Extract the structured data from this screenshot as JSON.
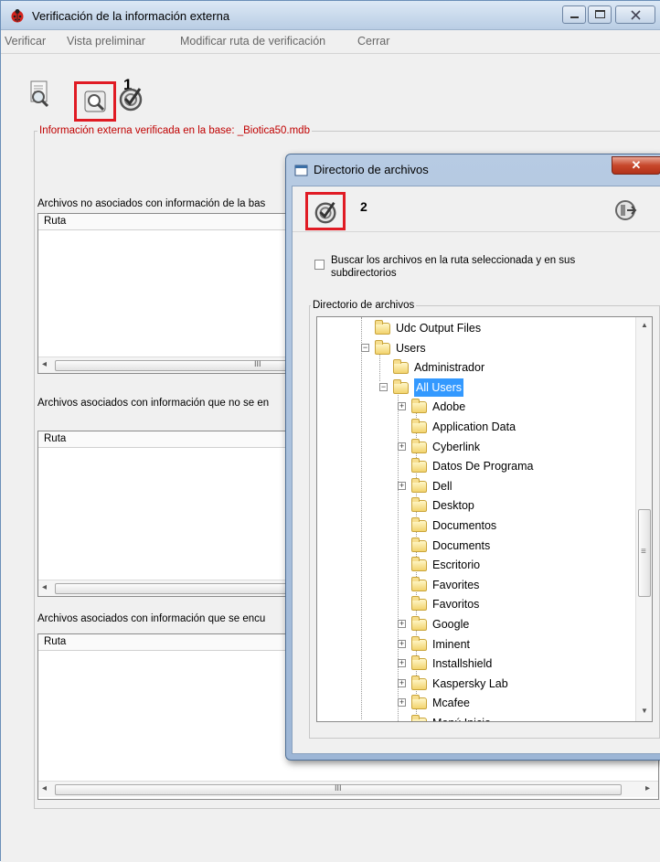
{
  "window": {
    "title": "Verificación de la información externa"
  },
  "menu": [
    "Verificar",
    "Vista preliminar",
    "Modificar ruta de verificación",
    "Cerrar"
  ],
  "toolbar": {
    "icons": [
      "preview-magnifier-icon",
      "verify-search-icon",
      "check-target-icon"
    ],
    "step_number": "1"
  },
  "group": {
    "label": "Información externa verificada en la base:  _Biotica50.mdb"
  },
  "sections": [
    {
      "label": "Archivos no asociados con información de la bas",
      "column": "Ruta"
    },
    {
      "label": "Archivos asociados con información que no se en",
      "column": "Ruta"
    },
    {
      "label": "Archivos asociados con información que se encu",
      "column": "Ruta"
    }
  ],
  "scroll_glyph": "III",
  "dialog": {
    "title": "Directorio de archivos",
    "step_number": "2",
    "checkbox_label": "Buscar los archivos en la ruta seleccionada y en sus subdirectorios",
    "tree_label": "Directorio de archivos",
    "scroll_glyph": "≡",
    "tree": [
      {
        "label": "Udc Output Files",
        "level": 0,
        "expander": ""
      },
      {
        "label": "Users",
        "level": 0,
        "expander": "−"
      },
      {
        "label": "Administrador",
        "level": 1,
        "expander": ""
      },
      {
        "label": "All Users",
        "level": 1,
        "expander": "−",
        "selected": true
      },
      {
        "label": "Adobe",
        "level": 2,
        "expander": "+"
      },
      {
        "label": "Application Data",
        "level": 2,
        "expander": ""
      },
      {
        "label": "Cyberlink",
        "level": 2,
        "expander": "+"
      },
      {
        "label": "Datos De Programa",
        "level": 2,
        "expander": ""
      },
      {
        "label": "Dell",
        "level": 2,
        "expander": "+"
      },
      {
        "label": "Desktop",
        "level": 2,
        "expander": ""
      },
      {
        "label": "Documentos",
        "level": 2,
        "expander": ""
      },
      {
        "label": "Documents",
        "level": 2,
        "expander": ""
      },
      {
        "label": "Escritorio",
        "level": 2,
        "expander": ""
      },
      {
        "label": "Favorites",
        "level": 2,
        "expander": ""
      },
      {
        "label": "Favoritos",
        "level": 2,
        "expander": ""
      },
      {
        "label": "Google",
        "level": 2,
        "expander": "+"
      },
      {
        "label": "Iminent",
        "level": 2,
        "expander": "+"
      },
      {
        "label": "Installshield",
        "level": 2,
        "expander": "+"
      },
      {
        "label": "Kaspersky Lab",
        "level": 2,
        "expander": "+"
      },
      {
        "label": "Mcafee",
        "level": 2,
        "expander": "+"
      },
      {
        "label": "Menú Inicio",
        "level": 2,
        "expander": ""
      }
    ]
  },
  "colors": {
    "highlight": "#e01b24",
    "group_label": "#c00000",
    "selection": "#3399ff"
  }
}
